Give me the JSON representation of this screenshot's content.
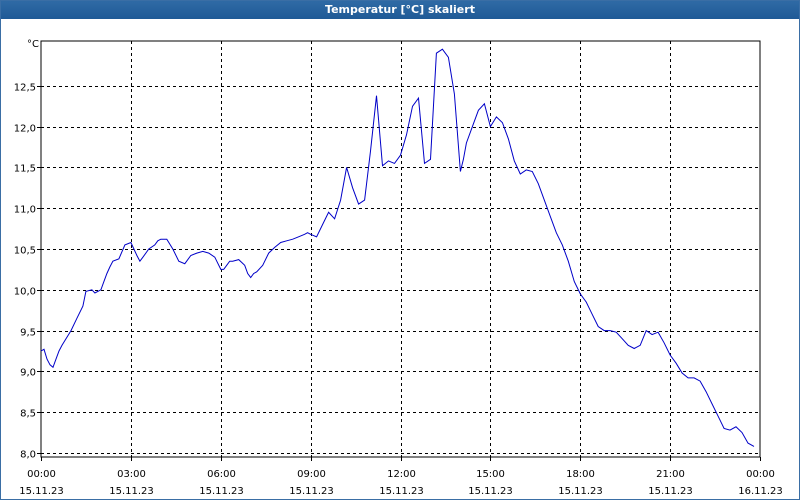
{
  "window": {
    "title": "Temperatur [°C] skaliert"
  },
  "colors": {
    "series": "#0000c8",
    "grid": "#000000",
    "titlebar": "#2a64a0"
  },
  "chart_data": {
    "type": "line",
    "title": "Temperatur [°C] skaliert",
    "ylabel": "°C",
    "xlabel": "",
    "grid": true,
    "ylim": [
      7.95,
      13.05
    ],
    "xlim": [
      0,
      24
    ],
    "y_ticks": [
      "8,0",
      "8,5",
      "9,0",
      "9,5",
      "10,0",
      "10,5",
      "11,0",
      "11,5",
      "12,0",
      "12,5"
    ],
    "y_tick_values": [
      8.0,
      8.5,
      9.0,
      9.5,
      10.0,
      10.5,
      11.0,
      11.5,
      12.0,
      12.5
    ],
    "x_ticks": [
      {
        "time": "00:00",
        "date": "15.11.23"
      },
      {
        "time": "03:00",
        "date": "15.11.23"
      },
      {
        "time": "06:00",
        "date": "15.11.23"
      },
      {
        "time": "09:00",
        "date": "15.11.23"
      },
      {
        "time": "12:00",
        "date": "15.11.23"
      },
      {
        "time": "15:00",
        "date": "15.11.23"
      },
      {
        "time": "18:00",
        "date": "15.11.23"
      },
      {
        "time": "21:00",
        "date": "15.11.23"
      },
      {
        "time": "00:00",
        "date": "16.11.23"
      }
    ],
    "series": [
      {
        "x": [
          0.0,
          0.1,
          0.2,
          0.3,
          0.4,
          0.5,
          0.6,
          0.7,
          0.8,
          1.0,
          1.2,
          1.4,
          1.5,
          1.7,
          1.8,
          2.0,
          2.1,
          2.2,
          2.3,
          2.4,
          2.6,
          2.8,
          3.0,
          3.1,
          3.2,
          3.3,
          3.4,
          3.6,
          3.8,
          3.9,
          4.0,
          4.2,
          4.4,
          4.6,
          4.8,
          5.0,
          5.2,
          5.4,
          5.6,
          5.8,
          6.0,
          6.1,
          6.2,
          6.3,
          6.4,
          6.6,
          6.8,
          6.9,
          7.0,
          7.1,
          7.2,
          7.4,
          7.6,
          7.8,
          8.0,
          8.2,
          8.4,
          8.6,
          8.8,
          8.9,
          9.0,
          9.2,
          9.4,
          9.6,
          9.8,
          10.0,
          10.2,
          10.4,
          10.6,
          10.8,
          11.0,
          11.2,
          11.4,
          11.6,
          11.8,
          12.0,
          12.2,
          12.4,
          12.6,
          12.8,
          13.0,
          13.2,
          13.4,
          13.6,
          13.8,
          14.0,
          14.1,
          14.2,
          14.4,
          14.6,
          14.8,
          15.0,
          15.2,
          15.4,
          15.6,
          15.8,
          16.0,
          16.2,
          16.4,
          16.6,
          16.8,
          17.0,
          17.2,
          17.4,
          17.6,
          17.8,
          18.0,
          18.2,
          18.4,
          18.6,
          18.8,
          19.0,
          19.2,
          19.4,
          19.6,
          19.8,
          20.0,
          20.2,
          20.4,
          20.6,
          20.8,
          21.0,
          21.2,
          21.4,
          21.6,
          21.8,
          22.0,
          22.2,
          22.4,
          22.6,
          22.8,
          23.0,
          23.2,
          23.4,
          23.6,
          23.8
        ],
        "y": [
          9.25,
          9.27,
          9.15,
          9.08,
          9.05,
          9.15,
          9.25,
          9.32,
          9.38,
          9.5,
          9.65,
          9.8,
          9.98,
          10.0,
          9.96,
          10.0,
          10.1,
          10.2,
          10.28,
          10.35,
          10.38,
          10.55,
          10.58,
          10.5,
          10.42,
          10.35,
          10.4,
          10.5,
          10.55,
          10.6,
          10.62,
          10.62,
          10.5,
          10.35,
          10.32,
          10.42,
          10.45,
          10.47,
          10.45,
          10.4,
          10.25,
          10.25,
          10.3,
          10.35,
          10.35,
          10.37,
          10.3,
          10.2,
          10.15,
          10.2,
          10.22,
          10.3,
          10.45,
          10.52,
          10.58,
          10.6,
          10.62,
          10.65,
          10.68,
          10.7,
          10.68,
          10.65,
          10.8,
          10.95,
          10.87,
          11.1,
          11.5,
          11.25,
          11.05,
          11.1,
          11.7,
          12.38,
          11.52,
          11.58,
          11.55,
          11.65,
          11.9,
          12.25,
          12.35,
          11.55,
          11.6,
          12.9,
          12.95,
          12.85,
          12.4,
          11.45,
          11.6,
          11.8,
          12.0,
          12.2,
          12.28,
          12.0,
          12.12,
          12.05,
          11.85,
          11.58,
          11.42,
          11.47,
          11.45,
          11.3,
          11.1,
          10.9,
          10.7,
          10.55,
          10.35,
          10.1,
          9.95,
          9.85,
          9.7,
          9.55,
          9.5,
          9.5,
          9.48,
          9.4,
          9.32,
          9.28,
          9.32,
          9.5,
          9.45,
          9.48,
          9.35,
          9.2,
          9.1,
          8.98,
          8.92,
          8.92,
          8.88,
          8.75,
          8.6,
          8.45,
          8.3,
          8.28,
          8.32,
          8.25,
          8.12,
          8.08
        ]
      }
    ]
  }
}
